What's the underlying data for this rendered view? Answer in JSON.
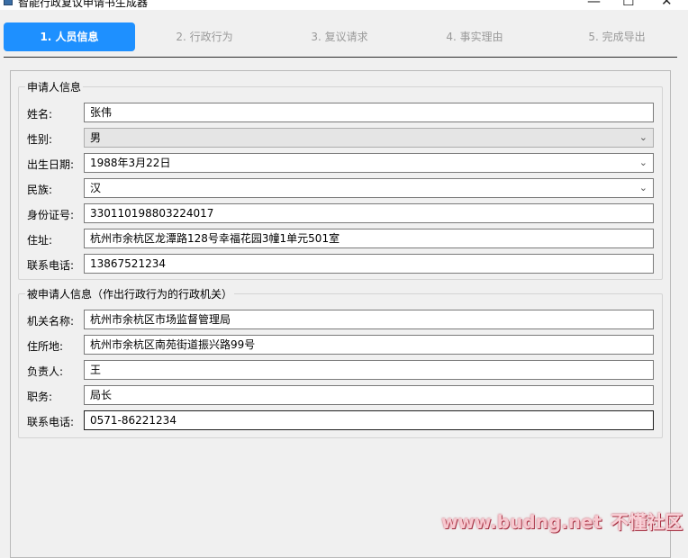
{
  "window": {
    "title": "智能行政复议申请书生成器",
    "minimize_glyph": "—",
    "maximize_glyph": "☐",
    "close_glyph": "✕"
  },
  "steps": [
    {
      "label": "1. 人员信息",
      "active": true
    },
    {
      "label": "2. 行政行为",
      "active": false
    },
    {
      "label": "3. 复议请求",
      "active": false
    },
    {
      "label": "4. 事实理由",
      "active": false
    },
    {
      "label": "5. 完成导出",
      "active": false
    }
  ],
  "applicant": {
    "group_title": "申请人信息",
    "name_label": "姓名:",
    "name_value": "张伟",
    "gender_label": "性别:",
    "gender_value": "男",
    "birth_label": "出生日期:",
    "birth_value": "1988年3月22日",
    "ethnicity_label": "民族:",
    "ethnicity_value": "汉",
    "id_label": "身份证号:",
    "id_value": "330110198803224017",
    "address_label": "住址:",
    "address_value": "杭州市余杭区龙潭路128号幸福花园3幢1单元501室",
    "phone_label": "联系电话:",
    "phone_value": "13867521234"
  },
  "respondent": {
    "group_title": "被申请人信息（作出行政行为的行政机关）",
    "org_label": "机关名称:",
    "org_value": "杭州市余杭区市场监督管理局",
    "location_label": "住所地:",
    "location_value": "杭州市余杭区南苑街道振兴路99号",
    "head_label": "负责人:",
    "head_value": "王",
    "position_label": "职务:",
    "position_value": "局长",
    "phone_label": "联系电话:",
    "phone_value": "0571-86221234"
  },
  "icons": {
    "dropdown": "chevron-down-icon",
    "app": "app-icon"
  },
  "watermark": {
    "url": "www.budng.net",
    "cn": "不懂社区"
  },
  "colors": {
    "active_step": "#1e90ff",
    "inactive_step_text": "#9a9a9a"
  }
}
